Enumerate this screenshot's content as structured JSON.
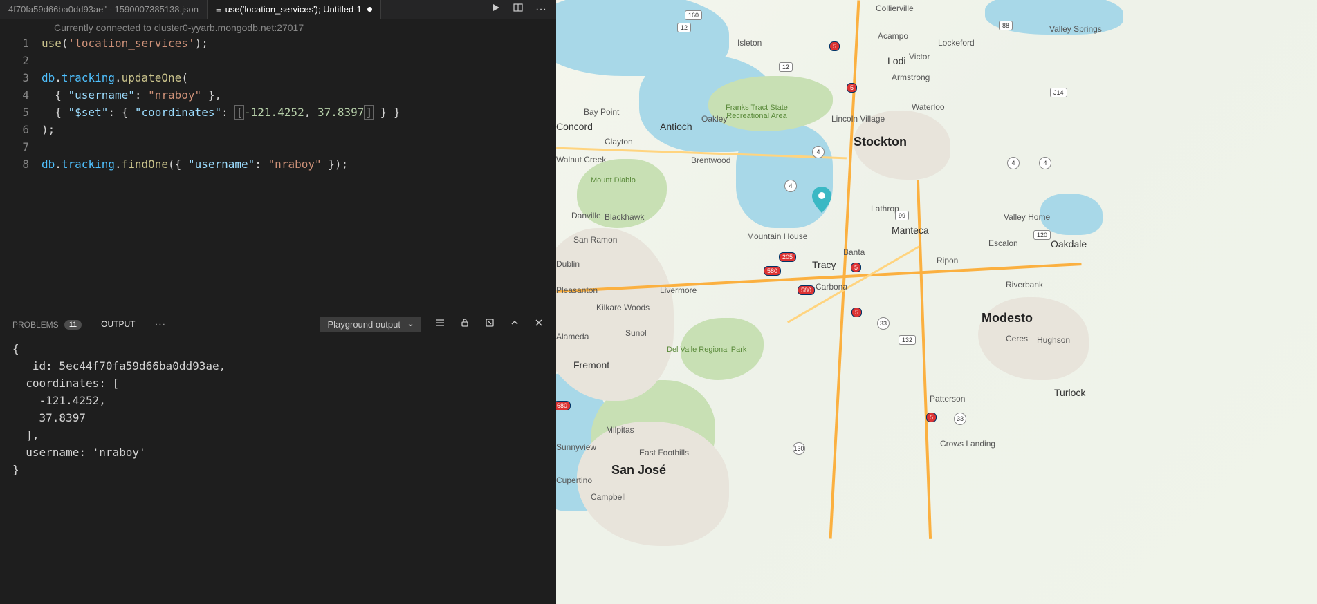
{
  "tabs": [
    {
      "label": "4f70fa59d66ba0dd93ae\" - 1590007385138.json",
      "active": false
    },
    {
      "label": "use('location_services');  Untitled-1",
      "active": true,
      "dirty": true
    }
  ],
  "connection": "Currently connected to cluster0-yyarb.mongodb.net:27017",
  "code_lines": [
    {
      "n": 1,
      "text": "use('location_services');"
    },
    {
      "n": 2,
      "text": ""
    },
    {
      "n": 3,
      "text": "db.tracking.updateOne("
    },
    {
      "n": 4,
      "text": "  { \"username\": \"nraboy\" },"
    },
    {
      "n": 5,
      "text": "  { \"$set\": { \"coordinates\": [-121.4252, 37.8397] } }"
    },
    {
      "n": 6,
      "text": ");"
    },
    {
      "n": 7,
      "text": ""
    },
    {
      "n": 8,
      "text": "db.tracking.findOne({ \"username\": \"nraboy\" });"
    }
  ],
  "panel": {
    "problems": {
      "label": "PROBLEMS",
      "count": "11"
    },
    "output": {
      "label": "OUTPUT"
    },
    "select_value": "Playground output"
  },
  "output": "{\n  _id: 5ec44f70fa59d66ba0dd93ae,\n  coordinates: [\n    -121.4252,\n    37.8397\n  ],\n  username: 'nraboy'\n}",
  "map": {
    "marker": {
      "lng": -121.4252,
      "lat": 37.8397
    },
    "big_cities": [
      "Stockton",
      "Modesto",
      "San José"
    ],
    "cities": [
      "Concord",
      "Antioch",
      "Oakley",
      "Brentwood",
      "Walnut Creek",
      "Clayton",
      "Danville",
      "Blackhawk",
      "San Ramon",
      "Dublin",
      "Pleasanton",
      "Livermore",
      "Sunol",
      "Fremont",
      "Milpitas",
      "Sunnyview",
      "East Foothills",
      "Campbell",
      "Cupertino",
      "Tracy",
      "Mountain House",
      "Manteca",
      "Lathrop",
      "Ripon",
      "Escalon",
      "Riverbank",
      "Ceres",
      "Hughson",
      "Oakdale",
      "Patterson",
      "Turlock",
      "Crows Landing",
      "Lodi",
      "Victor",
      "Lockeford",
      "Acampo",
      "Collierville",
      "Armstrong",
      "Waterloo",
      "Lincoln Village",
      "Valley Home",
      "Valley Springs",
      "Isleton",
      "Bay Point",
      "Banta",
      "Carbona",
      "Kilkare Woods",
      "Alameda",
      "Walnut Creek"
    ],
    "parks": [
      "Mount Diablo",
      "Franks Tract State Recreational Area",
      "Del Valle Regional Park"
    ],
    "shields": [
      "12",
      "680",
      "5",
      "580",
      "205",
      "99",
      "132",
      "33",
      "120",
      "88",
      "J14",
      "4",
      "160",
      "130"
    ]
  }
}
